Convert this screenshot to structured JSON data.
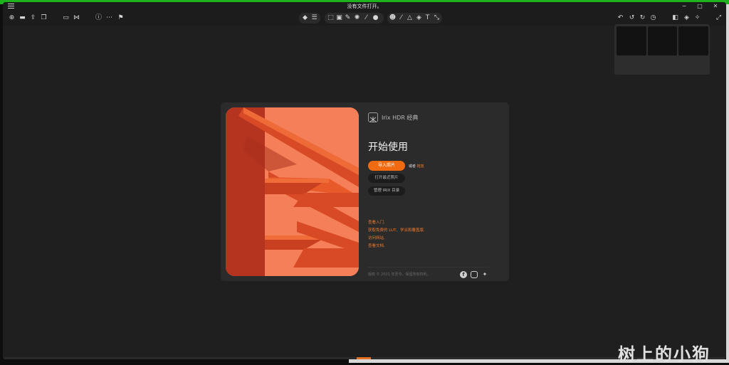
{
  "app": {
    "title": "没有文件打开。"
  },
  "window_controls": {
    "minimize": "−",
    "maximize": "□",
    "close": "✕"
  },
  "toolbar": {
    "left_icons": [
      "add-icon",
      "folder-icon",
      "export-icon",
      "copy-icon",
      "window-icon",
      "compare-icon",
      "info-icon",
      "more-icon",
      "flag-icon"
    ],
    "center_icons": [
      "tag-icon",
      "sliders-icon",
      "crop-icon",
      "crop-ratio-icon",
      "eyedropper-icon",
      "sparkle-icon",
      "brush-icon",
      "sticker-icon",
      "mask-icon",
      "wand-icon",
      "triangle-icon",
      "layers-icon",
      "text-icon",
      "transform-icon"
    ],
    "right_icons": [
      "undo-icon",
      "undo-icon",
      "redo-icon",
      "history-icon",
      "panel-icon",
      "layers-icon",
      "magic-icon",
      "expand-icon"
    ]
  },
  "dialog": {
    "logo_text": "Irix HDR 经典",
    "heading": "开始使用",
    "primary_button": "导入照片",
    "or_text": "或者",
    "or_link": "拖放",
    "open_recent_button": "打开最近照片",
    "manage_button": "管理 IRIX 目录",
    "links": [
      "查看入门.",
      "获取免费的 LUT、学派和覆盖版.",
      "访问网站.",
      "查看文档."
    ],
    "copyright": "版权 © 2021 年至今。保留所有权利。"
  },
  "watermark": "树上的小狗",
  "colors": {
    "accent": "#ef6a10",
    "bg": "#1f1f1f",
    "dialog_bg": "#2b2b2b"
  }
}
